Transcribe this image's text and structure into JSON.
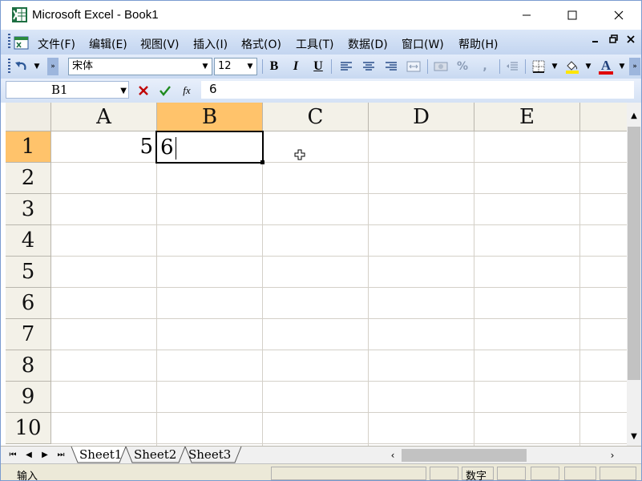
{
  "window": {
    "title": "Microsoft Excel - Book1"
  },
  "menu": {
    "items": [
      "文件(F)",
      "编辑(E)",
      "视图(V)",
      "插入(I)",
      "格式(O)",
      "工具(T)",
      "数据(D)",
      "窗口(W)",
      "帮助(H)"
    ]
  },
  "toolbar": {
    "font_name": "宋体",
    "font_size": "12",
    "bold_label": "B",
    "italic_label": "I",
    "underline_label": "U",
    "percent_label": "%",
    "comma_label": ",",
    "font_color_label": "A"
  },
  "formula_bar": {
    "name_box": "B1",
    "fx_label": "fx",
    "content": "6"
  },
  "grid": {
    "columns": [
      "A",
      "B",
      "C",
      "D",
      "E"
    ],
    "rows": [
      "1",
      "2",
      "3",
      "4",
      "5",
      "6",
      "7",
      "8",
      "9",
      "10"
    ],
    "selected_column": "B",
    "selected_row": "1",
    "cells": {
      "A1": "5",
      "B1": "6"
    }
  },
  "sheets": {
    "tabs": [
      "Sheet1",
      "Sheet2",
      "Sheet3"
    ],
    "active": "Sheet1"
  },
  "status": {
    "mode": "输入",
    "num_lock": "数字"
  },
  "colors": {
    "selected_header": "#ffc36b",
    "toolbar_blue": "#c3d5f0"
  }
}
